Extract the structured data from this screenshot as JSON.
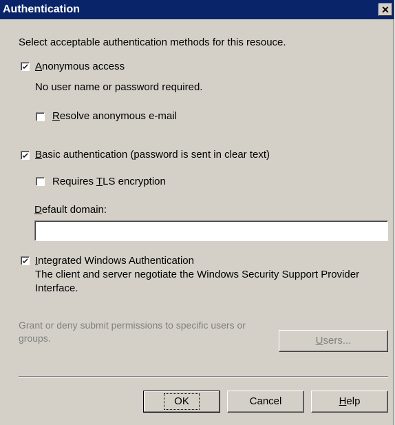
{
  "window": {
    "title": "Authentication",
    "close_glyph": "✕"
  },
  "intro_text": "Select acceptable authentication methods for this resouce.",
  "anonymous": {
    "checked": true,
    "label_mnemonic": "A",
    "label_rest": "nonymous access",
    "description": "No user name or password required.",
    "resolve": {
      "checked": false,
      "label_mnemonic": "R",
      "label_rest": "esolve anonymous e-mail"
    }
  },
  "basic": {
    "checked": true,
    "label_mnemonic": "B",
    "label_rest": "asic authentication (password is sent in clear text)",
    "tls": {
      "checked": false,
      "label_pre": "Requires ",
      "label_mnemonic": "T",
      "label_rest": "LS encryption"
    },
    "domain": {
      "label_mnemonic": "D",
      "label_rest": "efault domain:",
      "value": ""
    }
  },
  "integrated": {
    "checked": true,
    "label_mnemonic": "I",
    "label_rest": "ntegrated Windows Authentication",
    "description_line1": "The client and server negotiate the Windows Security Support Provider",
    "description_line2": "Interface."
  },
  "permissions": {
    "line1": "Grant or deny submit permissions to specific users or",
    "line2": "groups.",
    "users_button_mnemonic": "U",
    "users_button_rest": "sers..."
  },
  "buttons": {
    "ok": "OK",
    "cancel": "Cancel",
    "help_mnemonic": "H",
    "help_rest": "elp"
  }
}
